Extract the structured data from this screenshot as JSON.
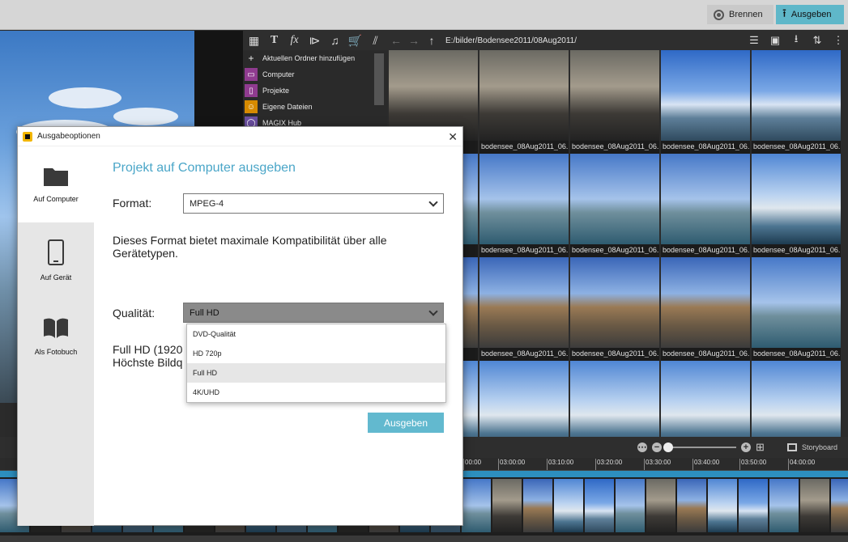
{
  "topbar": {
    "brennen_label": "Brennen",
    "ausgeben_label": "Ausgeben"
  },
  "media_pool": {
    "nav_items": [
      {
        "label": "Aktuellen Ordner hinzufügen",
        "icon": "plus-icon"
      },
      {
        "label": "Computer",
        "icon": "computer-icon"
      },
      {
        "label": "Projekte",
        "icon": "document-icon"
      },
      {
        "label": "Eigene Dateien",
        "icon": "user-icon"
      },
      {
        "label": "MAGIX Hub",
        "icon": "hub-icon"
      }
    ],
    "path": "E:/bilder/Bodensee2011/08Aug2011/",
    "thumb_caption": "bodensee_08Aug2011_06...",
    "thumb_caption_short": "06..."
  },
  "timeline": {
    "storyboard_label": "Storyboard",
    "ticks": [
      "00:00",
      "03:00:00",
      "03:10:00",
      "03:20:00",
      "03:30:00",
      "03:40:00",
      "03:50:00",
      "04:00:00"
    ]
  },
  "dialog": {
    "title": "Ausgabeoptionen",
    "sidebar": [
      {
        "label": "Auf Computer",
        "icon": "folder-icon"
      },
      {
        "label": "Auf Gerät",
        "icon": "phone-icon"
      },
      {
        "label": "Als Fotobuch",
        "icon": "book-icon"
      }
    ],
    "heading": "Projekt auf Computer ausgeben",
    "format_label": "Format:",
    "format_value": "MPEG-4",
    "format_description": "Dieses Format bietet maximale Kompatibilität über alle Gerätetypen.",
    "quality_label": "Qualität:",
    "quality_value": "Full HD",
    "quality_options": [
      "DVD-Qualität",
      "HD 720p",
      "Full HD",
      "4K/UHD"
    ],
    "quality_desc_line1": "Full HD (1920",
    "quality_desc_line2": "Höchste Bildq",
    "ausgeben_label": "Ausgeben"
  }
}
